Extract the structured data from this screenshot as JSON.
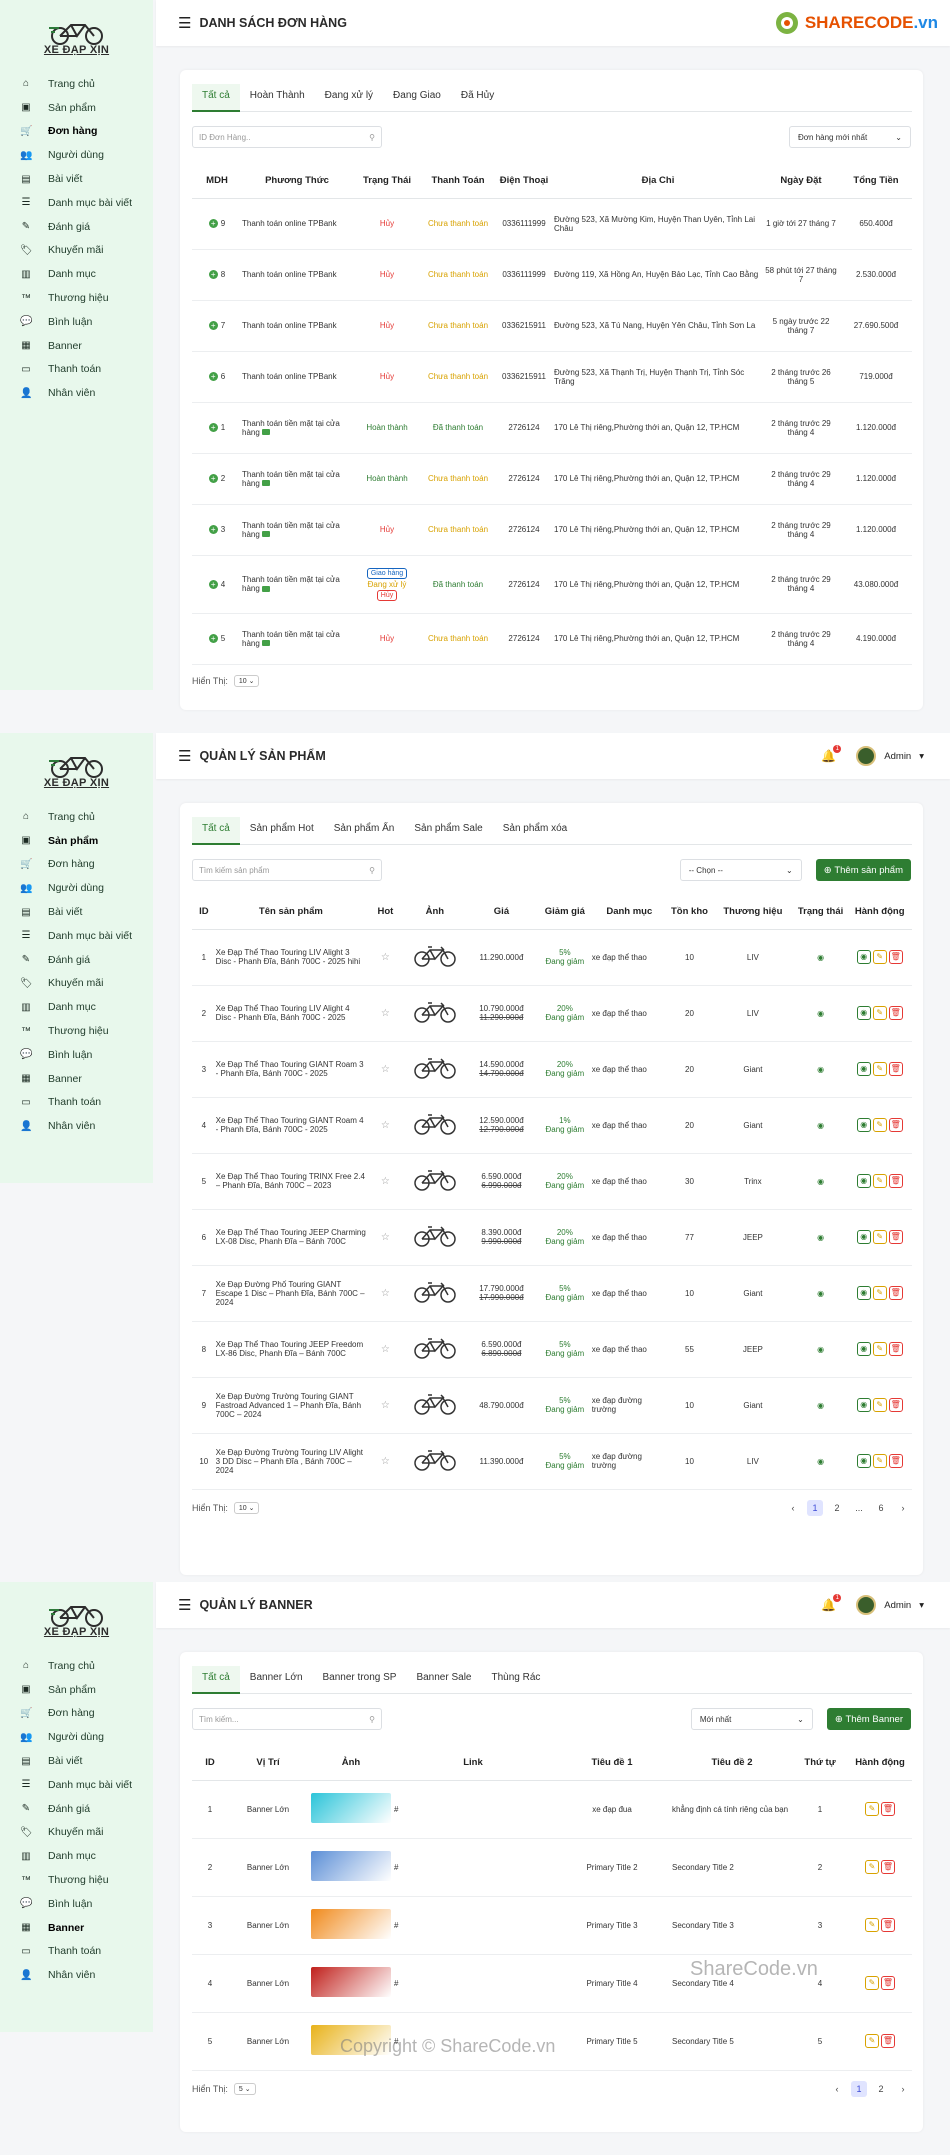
{
  "logo": {
    "text": "XE ĐẠP XỊN"
  },
  "nav": [
    "Trang chủ",
    "Sản phẩm",
    "Đơn hàng",
    "Người dùng",
    "Bài viết",
    "Danh mục bài viết",
    "Đánh giá",
    "Khuyến mãi",
    "Danh mục",
    "Thương hiệu",
    "Bình luận",
    "Banner",
    "Thanh toán",
    "Nhân viên"
  ],
  "brand": {
    "name": "SHARECODE",
    "tld": ".vn"
  },
  "admin": {
    "name": "Admin",
    "notif": "1"
  },
  "orders": {
    "title": "DANH SÁCH ĐƠN HÀNG",
    "tabs": [
      "Tất cả",
      "Hoàn Thành",
      "Đang xử lý",
      "Đang Giao",
      "Đã Hủy"
    ],
    "search_placeholder": "ID Đơn Hàng..",
    "sort": "Đơn hàng mới nhất",
    "headers": [
      "MDH",
      "Phương Thức",
      "Trạng Thái",
      "Thanh Toán",
      "Điện Thoại",
      "Địa Chỉ",
      "Ngày Đặt",
      "Tổng Tiền"
    ],
    "rows": [
      {
        "id": "9",
        "method": "Thanh toán online TPBank",
        "status": "Hủy",
        "pay": "Chưa thanh toán",
        "phone": "0336111999",
        "addr": "Đường 523, Xã Mường Kim, Huyện Than Uyên, Tỉnh Lai Châu",
        "date": "1 giờ tới 27 tháng 7",
        "total": "650.400đ"
      },
      {
        "id": "8",
        "method": "Thanh toán online TPBank",
        "status": "Hủy",
        "pay": "Chưa thanh toán",
        "phone": "0336111999",
        "addr": "Đường 119, Xã Hồng An, Huyện Bảo Lạc, Tỉnh Cao Bằng",
        "date": "58 phút tới 27 tháng 7",
        "total": "2.530.000đ"
      },
      {
        "id": "7",
        "method": "Thanh toán online TPBank",
        "status": "Hủy",
        "pay": "Chưa thanh toán",
        "phone": "0336215911",
        "addr": "Đường 523, Xã Tú Nang, Huyện Yên Châu, Tỉnh Sơn La",
        "date": "5 ngày trước 22 tháng 7",
        "total": "27.690.500đ"
      },
      {
        "id": "6",
        "method": "Thanh toán online TPBank",
        "status": "Hủy",
        "pay": "Chưa thanh toán",
        "phone": "0336215911",
        "addr": "Đường 523, Xã Thạnh Trị, Huyện Thạnh Trị, Tỉnh Sóc Trăng",
        "date": "2 tháng trước 26 tháng 5",
        "total": "719.000đ"
      },
      {
        "id": "1",
        "method": "Thanh toán tiền mặt tại cửa hàng",
        "status": "Hoàn thành",
        "pay": "Đã thanh toán",
        "phone": "2726124",
        "addr": "170 Lê Thị riêng,Phường thới an, Quận 12, TP.HCM",
        "date": "2 tháng trước 29 tháng 4",
        "total": "1.120.000đ"
      },
      {
        "id": "2",
        "method": "Thanh toán tiền mặt tại cửa hàng",
        "status": "Hoàn thành",
        "pay": "Chưa thanh toán",
        "phone": "2726124",
        "addr": "170 Lê Thị riêng,Phường thới an, Quận 12, TP.HCM",
        "date": "2 tháng trước 29 tháng 4",
        "total": "1.120.000đ"
      },
      {
        "id": "3",
        "method": "Thanh toán tiền mặt tại cửa hàng",
        "status": "Hủy",
        "pay": "Chưa thanh toán",
        "phone": "2726124",
        "addr": "170 Lê Thị riêng,Phường thới an, Quận 12, TP.HCM",
        "date": "2 tháng trước 29 tháng 4",
        "total": "1.120.000đ"
      },
      {
        "id": "4",
        "method": "Thanh toán tiền mặt tại cửa hàng",
        "status": "Đang xử lý",
        "pay": "Đã thanh toán",
        "phone": "2726124",
        "addr": "170 Lê Thị riêng,Phường thới an, Quận 12, TP.HCM",
        "date": "2 tháng trước 29 tháng 4",
        "total": "43.080.000đ"
      },
      {
        "id": "5",
        "method": "Thanh toán tiền mặt tại cửa hàng",
        "status": "Hủy",
        "pay": "Chưa thanh toán",
        "phone": "2726124",
        "addr": "170 Lê Thị riêng,Phường thới an, Quận 12, TP.HCM",
        "date": "2 tháng trước 29 tháng 4",
        "total": "4.190.000đ"
      }
    ],
    "badge_ship": "Giao hàng",
    "badge_cancel": "Hủy",
    "show_label": "Hiển Thị:",
    "show_value": "10"
  },
  "products": {
    "title": "QUẢN LÝ SẢN PHẨM",
    "tabs": [
      "Tất cả",
      "Sản phẩm Hot",
      "Sản phẩm Ẩn",
      "Sản phẩm Sale",
      "Sản phẩm xóa"
    ],
    "search_placeholder": "Tìm kiếm sản phẩm",
    "filter": "-- Chọn --",
    "add": "Thêm sản phẩm",
    "headers": [
      "ID",
      "Tên sản phẩm",
      "Hot",
      "Ảnh",
      "Giá",
      "Giảm giá",
      "Danh mục",
      "Tồn kho",
      "Thương hiệu",
      "Trạng thái",
      "Hành động"
    ],
    "rows": [
      {
        "id": "1",
        "name": "Xe Đạp Thể Thao Touring LIV Alight 3 Disc - Phanh Đĩa, Bánh 700C - 2025 hihi",
        "price": "11.290.000đ",
        "old": "",
        "disc": "5%",
        "cat": "xe đạp thể thao",
        "stock": "10",
        "brand": "LIV"
      },
      {
        "id": "2",
        "name": "Xe Đạp Thể Thao Touring LIV Alight 4 Disc - Phanh Đĩa, Bánh 700C - 2025",
        "price": "10.790.000đ",
        "old": "11.290.000đ",
        "disc": "20%",
        "cat": "xe đạp thể thao",
        "stock": "20",
        "brand": "LIV"
      },
      {
        "id": "3",
        "name": "Xe Đạp Thể Thao Touring GIANT Roam 3 - Phanh Đĩa, Bánh 700C - 2025",
        "price": "14.590.000đ",
        "old": "14.790.000đ",
        "disc": "20%",
        "cat": "xe đạp thể thao",
        "stock": "20",
        "brand": "Giant"
      },
      {
        "id": "4",
        "name": "Xe Đạp Thể Thao Touring GIANT Roam 4 - Phanh Đĩa, Bánh 700C - 2025",
        "price": "12.590.000đ",
        "old": "12.790.000đ",
        "disc": "1%",
        "cat": "xe đạp thể thao",
        "stock": "20",
        "brand": "Giant"
      },
      {
        "id": "5",
        "name": "Xe Đạp Thể Thao Touring TRINX Free 2.4 – Phanh Đĩa, Bánh 700C – 2023",
        "price": "6.590.000đ",
        "old": "6.990.000đ",
        "disc": "20%",
        "cat": "xe đạp thể thao",
        "stock": "30",
        "brand": "Trinx"
      },
      {
        "id": "6",
        "name": "Xe Đạp Thể Thao Touring JEEP Charming LX-08 Disc, Phanh Đĩa – Bánh 700C",
        "price": "8.390.000đ",
        "old": "9.990.000đ",
        "disc": "20%",
        "cat": "xe đạp thể thao",
        "stock": "77",
        "brand": "JEEP"
      },
      {
        "id": "7",
        "name": "Xe Đạp Đường Phố Touring GIANT Escape 1 Disc – Phanh Đĩa, Bánh 700C – 2024",
        "price": "17.790.000đ",
        "old": "17.990.000đ",
        "disc": "5%",
        "cat": "xe đạp thể thao",
        "stock": "10",
        "brand": "Giant"
      },
      {
        "id": "8",
        "name": "Xe Đạp Thể Thao Touring JEEP Freedom LX-86 Disc, Phanh Đĩa – Bánh 700C",
        "price": "6.590.000đ",
        "old": "6.890.000đ",
        "disc": "5%",
        "cat": "xe đạp thể thao",
        "stock": "55",
        "brand": "JEEP"
      },
      {
        "id": "9",
        "name": "Xe Đạp Đường Trường Touring GIANT Fastroad Advanced 1 – Phanh Đĩa, Bánh 700C – 2024",
        "price": "48.790.000đ",
        "old": "",
        "disc": "5%",
        "cat": "xe đạp đường trường",
        "stock": "10",
        "brand": "Giant"
      },
      {
        "id": "10",
        "name": "Xe Đạp Đường Trường Touring LIV Alight 3 DD Disc – Phanh Đĩa , Bánh 700C – 2024",
        "price": "11.390.000đ",
        "old": "",
        "disc": "5%",
        "cat": "xe đạp đường trường",
        "stock": "10",
        "brand": "LIV"
      }
    ],
    "disc_label": "Đang giảm",
    "show_label": "Hiển Thị:",
    "show_value": "10",
    "pages": [
      "1",
      "2",
      "...",
      "6"
    ]
  },
  "banners": {
    "title": "QUẢN LÝ BANNER",
    "tabs": [
      "Tất cả",
      "Banner Lớn",
      "Banner trong SP",
      "Banner Sale",
      "Thùng Rác"
    ],
    "search_placeholder": "Tìm kiếm...",
    "sort": "Mới nhất",
    "add": "Thêm Banner",
    "headers": [
      "ID",
      "Vị Trí",
      "Ảnh",
      "Link",
      "Tiêu đề 1",
      "Tiêu đề 2",
      "Thứ tự",
      "Hành động"
    ],
    "rows": [
      {
        "id": "1",
        "pos": "Banner Lớn",
        "link": "#",
        "t1": "xe đạp đua",
        "t2": "khẳng định cá tính riêng của bạn",
        "order": "1",
        "color": "#2bc4d9"
      },
      {
        "id": "2",
        "pos": "Banner Lớn",
        "link": "#",
        "t1": "Primary Title 2",
        "t2": "Secondary Title 2",
        "order": "2",
        "color": "#5b8ed6"
      },
      {
        "id": "3",
        "pos": "Banner Lớn",
        "link": "#",
        "t1": "Primary Title 3",
        "t2": "Secondary Title 3",
        "order": "3",
        "color": "#f08a1c"
      },
      {
        "id": "4",
        "pos": "Banner Lớn",
        "link": "#",
        "t1": "Primary Title 4",
        "t2": "Secondary Title 4",
        "order": "4",
        "color": "#c0201b"
      },
      {
        "id": "5",
        "pos": "Banner Lớn",
        "link": "#",
        "t1": "Primary Title 5",
        "t2": "Secondary Title 5",
        "order": "5",
        "color": "#e8b21a"
      }
    ],
    "show_label": "Hiển Thị:",
    "show_value": "5",
    "pages": [
      "1",
      "2"
    ]
  },
  "watermark": {
    "a": "ShareCode.vn",
    "b": "Copyright © ShareCode.vn"
  }
}
